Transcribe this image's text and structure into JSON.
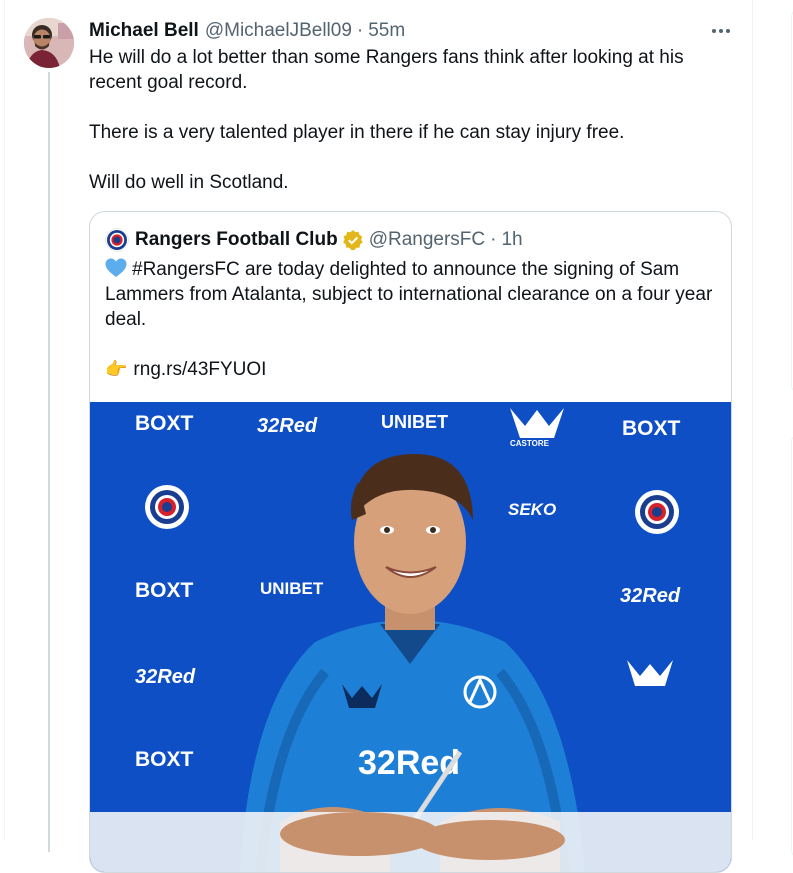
{
  "tweet": {
    "author_name": "Michael Bell",
    "author_handle": "@MichaelJBell09",
    "separator": "·",
    "time": "55m",
    "paragraphs": [
      "He will do a lot better than some Rangers fans think after looking at his recent goal record.",
      "There is a very talented player in there if he can stay injury free.",
      "Will do well in Scotland."
    ]
  },
  "quote": {
    "author_name": "Rangers Football Club",
    "author_handle": "@RangersFC",
    "separator": "·",
    "time": "1h",
    "text_main": "#RangersFC are today delighted to announce the signing of Sam Lammers from Atalanta, subject to international clearance on a four year deal.",
    "link_text": "rng.rs/43FYUOI"
  },
  "media": {
    "backdrop_sponsors": [
      "BOXT",
      "32Red",
      "UNIBET",
      "CASTORE",
      "BOXT",
      "SEKO",
      "BOXT",
      "UNIBET",
      "32Red",
      "32Red",
      "BOXT",
      "32Red"
    ],
    "shirt_sponsor": "32Red"
  },
  "colors": {
    "text_primary": "#0f1419",
    "text_secondary": "#536471",
    "border": "#cfd9de",
    "verified_gold": "#e2b719",
    "backdrop_blue": "#0e4fc5",
    "shirt_blue": "#1d7fd6"
  },
  "icons": [
    "more-icon",
    "verified-badge-icon",
    "blue-heart-icon",
    "pointing-finger-icon",
    "rangers-crest-icon"
  ]
}
